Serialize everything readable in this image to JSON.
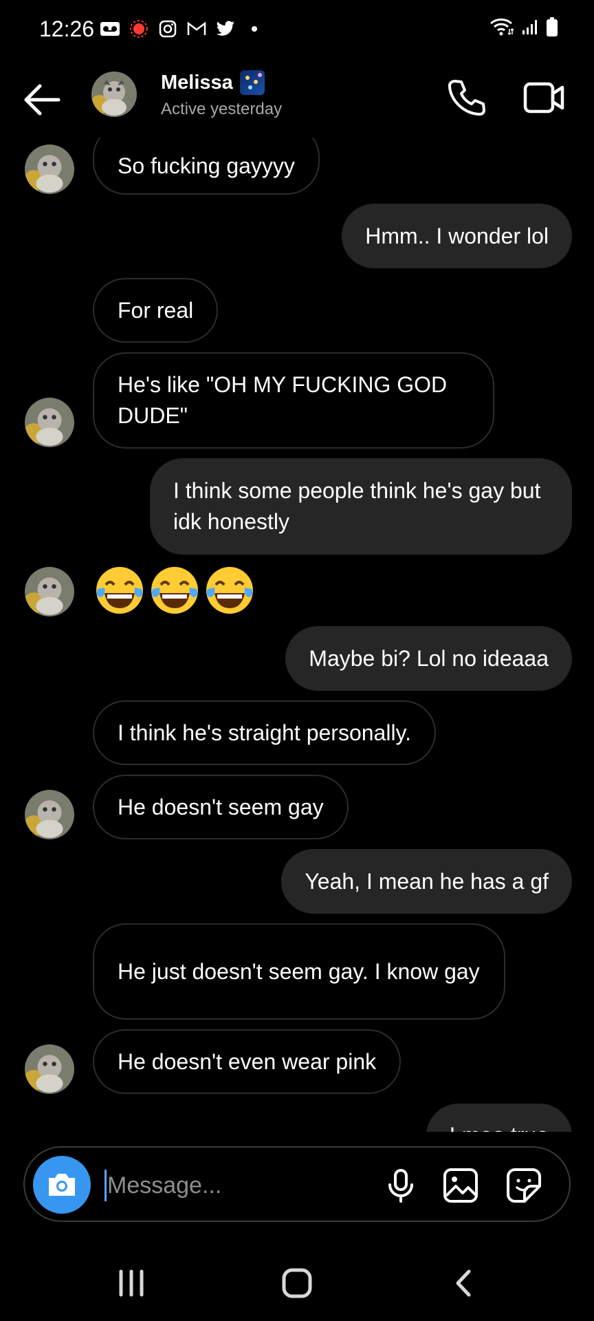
{
  "status_bar": {
    "time": "12:26",
    "left_icons": [
      "voicemail-icon",
      "record-icon",
      "instagram-icon",
      "gmail-icon",
      "twitter-icon",
      "dot-icon"
    ],
    "right_icons": [
      "wifi-icon",
      "signal-icon",
      "battery-icon"
    ]
  },
  "header": {
    "name": "Melissa",
    "name_emoji": "fireworks-emoji",
    "status": "Active yesterday"
  },
  "messages": [
    {
      "side": "in",
      "text": "So fucking gayyyy",
      "avatar": true
    },
    {
      "side": "out",
      "text": "Hmm.. I wonder lol"
    },
    {
      "side": "in",
      "text": "For real",
      "avatar": false
    },
    {
      "side": "in",
      "text": "He's like \"OH MY FUCKING GOD DUDE\"",
      "avatar": true
    },
    {
      "side": "out",
      "text": "I think some people think he's gay but idk honestly"
    },
    {
      "side": "in",
      "emoji": "😂😂😂",
      "avatar": true
    },
    {
      "side": "out",
      "text": "Maybe bi? Lol no ideaaa"
    },
    {
      "side": "in",
      "text": "I think he's straight personally.",
      "avatar": false
    },
    {
      "side": "in",
      "text": "He doesn't seem gay",
      "avatar": true
    },
    {
      "side": "out",
      "text": "Yeah, I mean he has a gf"
    },
    {
      "side": "in",
      "text": "He just doesn't seem gay. I know gay",
      "avatar": false
    },
    {
      "side": "in",
      "text": "He doesn't even wear pink",
      "avatar": true
    },
    {
      "side": "out",
      "text": "Lmao true"
    }
  ],
  "composer": {
    "placeholder": "Message...",
    "icons": [
      "camera-icon",
      "microphone-icon",
      "gallery-icon",
      "sticker-icon"
    ]
  },
  "colors": {
    "background": "#000000",
    "outgoing_bubble": "#262626",
    "incoming_border": "#2c2c2c",
    "camera_button": "#3797f0",
    "secondary_text": "#a8a8a8"
  }
}
